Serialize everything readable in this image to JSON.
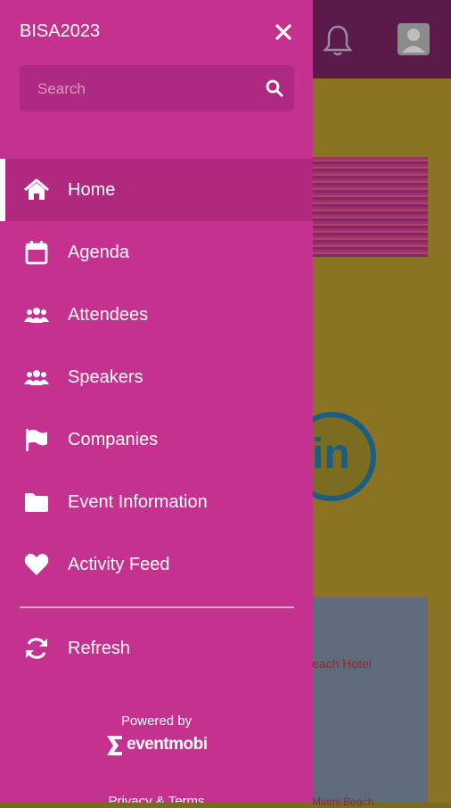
{
  "drawer": {
    "title": "BISA2023",
    "search_placeholder": "Search",
    "items": [
      {
        "label": "Home",
        "icon": "home-icon",
        "active": true
      },
      {
        "label": "Agenda",
        "icon": "calendar-icon",
        "active": false
      },
      {
        "label": "Attendees",
        "icon": "people-icon",
        "active": false
      },
      {
        "label": "Speakers",
        "icon": "people-icon",
        "active": false
      },
      {
        "label": "Companies",
        "icon": "flag-icon",
        "active": false
      },
      {
        "label": "Event Information",
        "icon": "folder-icon",
        "active": false
      },
      {
        "label": "Activity Feed",
        "icon": "heart-icon",
        "active": false
      }
    ],
    "refresh_label": "Refresh",
    "powered_by": "Powered by",
    "brand": "eventmobi",
    "privacy_terms": "Privacy & Terms"
  },
  "background": {
    "linkedin_text": "in",
    "card_text": "each Hotel",
    "card_text_2": "Miami Beach"
  },
  "colors": {
    "drawer": "#c4318f",
    "active_item": "#b1287f",
    "search_bg": "#ae2a82",
    "header": "#5a1a4a"
  }
}
